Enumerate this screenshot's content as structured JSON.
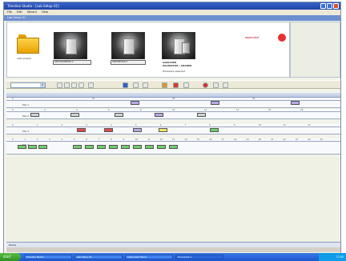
{
  "window": {
    "title": "Timeline Studio - [Lab Setup 01]"
  },
  "menu": {
    "items": [
      "File",
      "Edit",
      "Wizard",
      "Help"
    ]
  },
  "subbar": {
    "label": "Lab Setup 01"
  },
  "items_panel": {
    "folder_caption": "Instruments",
    "instruments": [
      {
        "caption": "SPECTROMETER 2"
      },
      {
        "caption": "CENTRIFUGE 4"
      },
      {
        "caption": "ANALYZER",
        "caption2": "INCUBATOR / SHAKER",
        "caption3": "Hardware selected"
      }
    ]
  },
  "logo": {
    "text": "eppendorf"
  },
  "toolbar": {
    "dropdown_value": "",
    "icons": [
      "open-icon",
      "save-icon",
      "cut-icon",
      "copy-icon",
      "paste-icon",
      "pointer-icon",
      "chart-icon",
      "link-icon",
      "start-icon",
      "stop-icon",
      "record-icon",
      "delete-icon",
      "zoom-in-icon",
      "zoom-out-icon"
    ]
  },
  "timeline": {
    "lanes": [
      {
        "label": "Mix 1",
        "tick_labels": [
          "0",
          "10",
          "20",
          "30"
        ]
      },
      {
        "label": "Mix 2",
        "tick_labels": [
          "0",
          "2",
          "4",
          "6",
          "8",
          "10",
          "12",
          "14",
          "16",
          "18"
        ]
      },
      {
        "label": "Mix 3",
        "tick_labels": [
          "0",
          "1",
          "2",
          "3",
          "4",
          "5",
          "6",
          "7",
          "8",
          "9",
          "10",
          "11",
          "12"
        ]
      },
      {
        "label": "Mix 4",
        "tick_labels": [
          "0",
          "1",
          "2",
          "3",
          "4",
          "5",
          "6",
          "7",
          "8",
          "9",
          "10",
          "11",
          "12",
          "13",
          "14",
          "15",
          "16",
          "17",
          "18",
          "19",
          "20",
          "21",
          "22",
          "23",
          "24",
          "25"
        ]
      }
    ],
    "colors": {
      "purple": "#b9a9e6",
      "gray": "#cfd3d8",
      "red": "#e64a4a",
      "yellow": "#f4e36a",
      "green": "#6fcf6a"
    }
  },
  "statusbar": {
    "text": "Ready"
  },
  "taskbar": {
    "start_label": "start",
    "items": [
      "Timeline Studio",
      "Lab Setup 01",
      "Instrument Panel",
      "Document 1"
    ],
    "clock": "11:05"
  }
}
